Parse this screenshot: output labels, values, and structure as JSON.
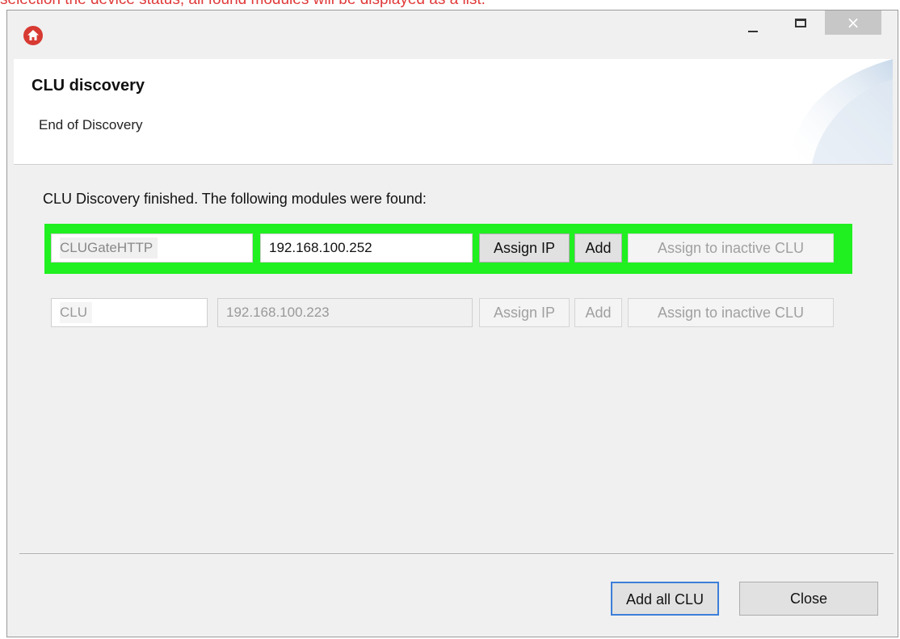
{
  "caption": "selection the device status, all found modules will be displayed as a list.",
  "window": {
    "close_glyph": "×"
  },
  "header": {
    "title": "CLU discovery",
    "subtitle": "End of Discovery"
  },
  "main": {
    "status_text": "CLU Discovery finished. The following modules were found:",
    "modules": [
      {
        "name": "CLUGateHTTP",
        "ip": "192.168.100.252",
        "assign_ip_label": "Assign IP",
        "add_label": "Add",
        "assign_inactive_label": "Assign to inactive CLU",
        "state": "active",
        "highlight_color": "#20f020"
      },
      {
        "name": "CLU",
        "ip": "192.168.100.223",
        "assign_ip_label": "Assign IP",
        "add_label": "Add",
        "assign_inactive_label": "Assign to inactive CLU",
        "state": "disabled"
      }
    ]
  },
  "footer": {
    "add_all_label": "Add all CLU",
    "close_label": "Close"
  },
  "colors": {
    "app_icon": "#d73a32",
    "caption_text": "#e03a3a",
    "focus_border": "#3c7fd9"
  },
  "icons": {
    "app": "home-icon",
    "minimize": "minimize-icon",
    "maximize": "maximize-icon",
    "close": "close-icon"
  }
}
